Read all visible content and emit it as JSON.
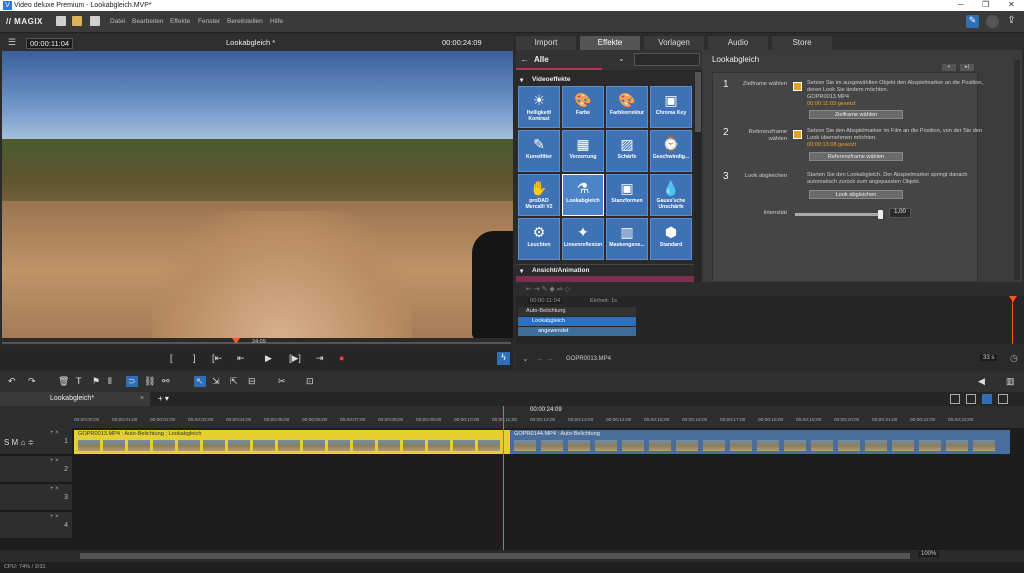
{
  "window": {
    "title": "Video deluxe Premium - Lookabgleich.MVP*",
    "controls": [
      "─",
      "❐",
      "✕"
    ]
  },
  "menu": {
    "logo": "// MAGIX",
    "items": [
      "Datei",
      "Bearbeiten",
      "Effekte",
      "Fenster",
      "Bereitstellen",
      "Hilfe"
    ]
  },
  "preview": {
    "timecode_left": "00:00:11:04",
    "title": "Lookabgleich *",
    "timecode_right": "00:00:24:09",
    "marker_time": "24:09"
  },
  "transport": {
    "buttons": [
      "[",
      "]",
      "[⇤",
      "⇤",
      "▶",
      "[▶]",
      "⇥",
      "●"
    ]
  },
  "panel": {
    "tabs": [
      "Import",
      "Effekte",
      "Vorlagen",
      "Audio",
      "Store"
    ],
    "active_tab": "Effekte",
    "filter": "Alle",
    "section_video": "Videoeffekte",
    "section_anim": "Ansicht/Animation",
    "effects": [
      {
        "label": "Helligkeit/ Kontrast",
        "icon": "☀"
      },
      {
        "label": "Farbe",
        "icon": "🎨"
      },
      {
        "label": "Farbkorrektur",
        "icon": "🎨"
      },
      {
        "label": "Chroma Key",
        "icon": "▣"
      },
      {
        "label": "Kunstfilter",
        "icon": "✎"
      },
      {
        "label": "Verzerrung",
        "icon": "▦"
      },
      {
        "label": "Schärfe",
        "icon": "▨"
      },
      {
        "label": "Geschwindig...",
        "icon": "⌚"
      },
      {
        "label": "proDAD Mercalli V2",
        "icon": "✋"
      },
      {
        "label": "Lookabgleich",
        "icon": "⚗"
      },
      {
        "label": "Stanzformen",
        "icon": "▣"
      },
      {
        "label": "Gauss'sche Unschärfe",
        "icon": "💧"
      },
      {
        "label": "Leuchten",
        "icon": "⚙"
      },
      {
        "label": "Linsenreflexion",
        "icon": "✦"
      },
      {
        "label": "Maskengene...",
        "icon": "▥"
      },
      {
        "label": "Standard",
        "icon": "⬢"
      }
    ]
  },
  "settings": {
    "title": "Lookabgleich",
    "steps": [
      {
        "num": "1",
        "label": "Zielframe wählen",
        "desc": "Setzen Sie im ausgewählten Objekt den Abspielmarker an die Position, deren Look Sie ändern möchten.",
        "file": "GOPR0013.MP4",
        "time": "00:00:11:03 gesetzt",
        "button": "Zielframe wählen"
      },
      {
        "num": "2",
        "label": "Referenzframe wählen",
        "desc": "Setzen Sie den Abspielmarker im Film an die Position, von der Sie den Look übernehmen möchten.",
        "time": "00:00:13:08 gesetzt",
        "button": "Referenzframe wählen"
      },
      {
        "num": "3",
        "label": "Look abgleichen",
        "desc": "Starten Sie den Lookabgleich. Der Abspielmarker springt danach automatisch zurück zum angepassten Objekt.",
        "button": "Look abgleichen"
      }
    ],
    "intensity_label": "Intensität",
    "intensity_value": "1,00",
    "intensity_fraction": 1.0
  },
  "keyframes": {
    "time": "00:00:11:04",
    "unit": "Einheit: 1s",
    "rows": [
      "Auto-Belichtung",
      "Lookabgleich",
      "angewendet"
    ],
    "clip_name": "GOPR0013.MP4",
    "zoom": "33 s"
  },
  "timeline": {
    "tab": "Lookabgleich*",
    "playhead_time": "00:00:24:09",
    "ruler": [
      "00;00;00;00",
      "00;00;01;00",
      "00;00;02;00",
      "00;00;03;00",
      "00;00;04;00",
      "00;00;05;00",
      "00;00;06;00",
      "00;00;07;00",
      "00;00;08;00",
      "00;00;09;00",
      "00;00;10;00",
      "00;00;11;00",
      "00;00;12;00",
      "00;00;13;00",
      "00;00;14;00",
      "00;00;15;00",
      "00;00;16;00",
      "00;00;17;00",
      "00;00;18;00",
      "00;00;19;00",
      "00;00;20;00",
      "00;00;21;00",
      "00;00;22;00",
      "00;00;23;00"
    ],
    "track_numbers": [
      "1",
      "2",
      "3",
      "4"
    ],
    "clip1": "GOPR0013.MP4 : Auto-Belichtung ; Lookabgleich",
    "clip2": "GOPR0144.MP4 : Auto-Belichtung",
    "zoom": "100%"
  },
  "status": {
    "text": "CPU: 74% / 2/31"
  }
}
